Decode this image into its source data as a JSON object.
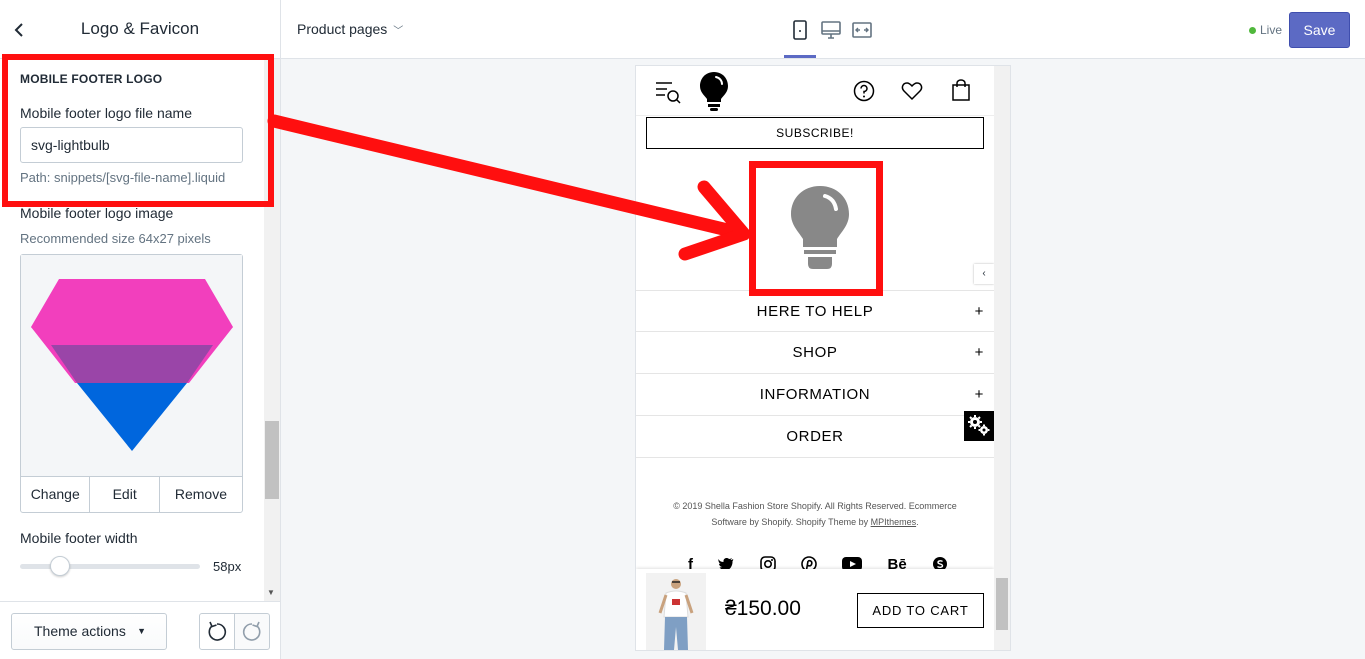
{
  "sidebar": {
    "title": "Logo & Favicon",
    "section_title": "MOBILE FOOTER LOGO",
    "file_name_label": "Mobile footer logo file name",
    "file_name_value": "svg-lightbulb",
    "file_name_help": "Path: snippets/[svg-file-name].liquid",
    "image_label": "Mobile footer logo image",
    "image_help": "Recommended size 64x27 pixels",
    "image_actions": [
      "Change",
      "Edit",
      "Remove"
    ],
    "width_label": "Mobile footer width",
    "width_value": "58px",
    "width_fraction": 0.2,
    "theme_actions_label": "Theme actions"
  },
  "topbar": {
    "page_select": "Product pages",
    "devices": [
      "mobile-icon",
      "desktop-icon",
      "fullscreen-icon"
    ],
    "active_device": "mobile",
    "live_label": "Live",
    "save_label": "Save"
  },
  "preview": {
    "subscribe_label": "SUBSCRIBE!",
    "accordion": [
      "HERE TO HELP",
      "SHOP",
      "INFORMATION",
      "ORDER"
    ],
    "copyright_line1": "© 2019 Shella Fashion Store Shopify. All Rights Reserved. Ecommerce",
    "copyright_line2_prefix": "Software by Shopify. Shopify Theme by ",
    "copyright_link": "MPIthemes",
    "copyright_line2_suffix": ".",
    "socials": [
      "facebook-icon",
      "twitter-icon",
      "instagram-icon",
      "pinterest-icon",
      "youtube-icon",
      "behance-icon",
      "skype-icon"
    ],
    "behance_text": "Bē",
    "price": "₴150.00",
    "add_to_cart_label": "ADD TO CART"
  },
  "colors": {
    "accent": "#5c6ac4",
    "annotation_red": "#ff0f0f",
    "live_green": "#50b83c",
    "diamond_pink": "#f23fbd",
    "diamond_purple": "#9a45a8",
    "diamond_blue": "#0066dd",
    "bulb_gray": "#888888"
  }
}
